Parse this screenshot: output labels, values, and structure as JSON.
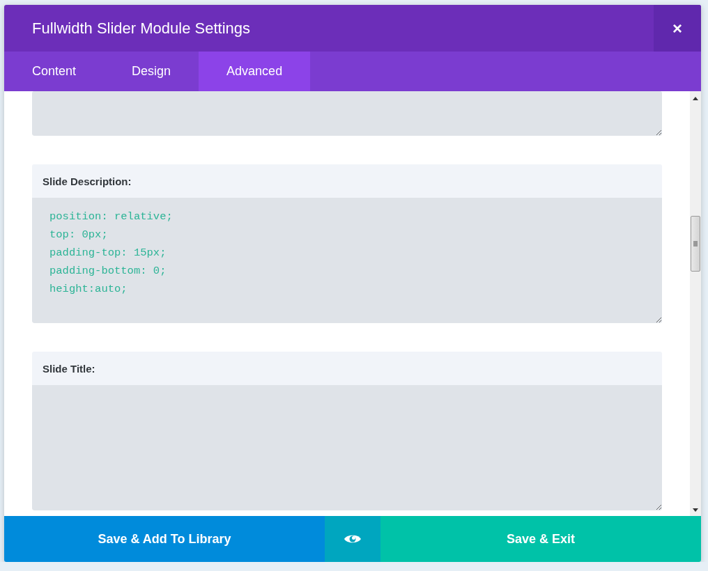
{
  "window": {
    "title": "Fullwidth Slider Module Settings",
    "close": "×"
  },
  "tabs": [
    {
      "label": "Content",
      "selected": false
    },
    {
      "label": "Design",
      "selected": false
    },
    {
      "label": "Advanced",
      "selected": true
    }
  ],
  "fields": [
    {
      "kind": "partial"
    },
    {
      "kind": "full",
      "label": "Slide Description:",
      "value": "position: relative;\ntop: 0px;\npadding-top: 15px;\npadding-bottom: 0;\nheight:auto;"
    },
    {
      "kind": "full",
      "label": "Slide Title:"
    }
  ],
  "footer": {
    "save_library": "Save & Add To Library",
    "save_exit": "Save & Exit"
  }
}
